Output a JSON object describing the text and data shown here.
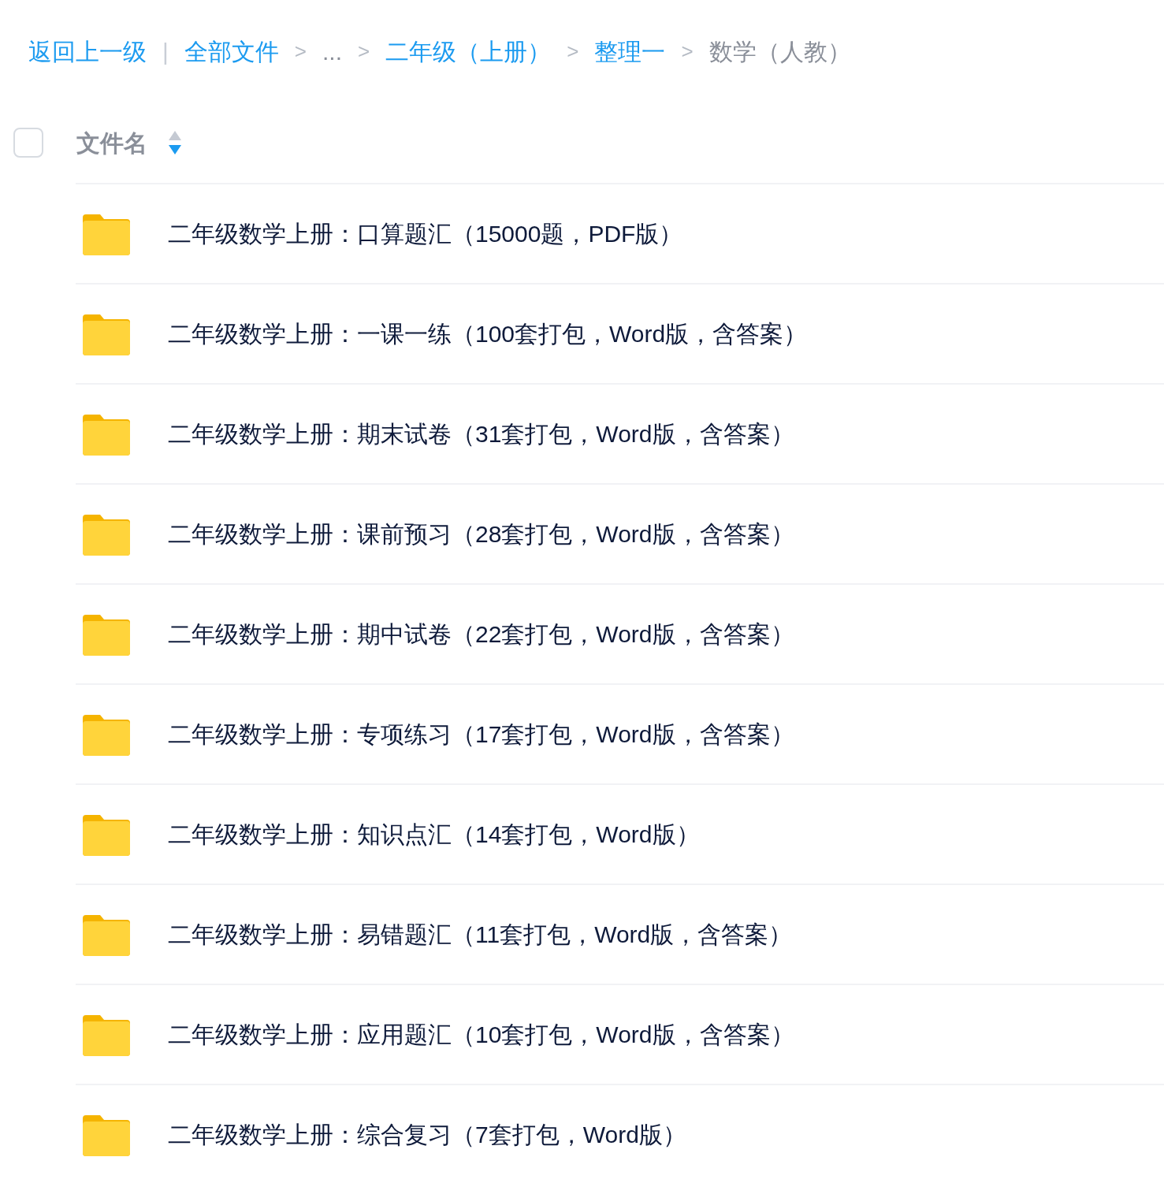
{
  "breadcrumb": {
    "back": "返回上一级",
    "divider": "|",
    "items": [
      {
        "label": "全部文件",
        "kind": "link"
      },
      {
        "separator": ">",
        "label": "...",
        "kind": "text"
      },
      {
        "separator": ">",
        "label": "二年级（上册）",
        "kind": "link"
      },
      {
        "separator": ">",
        "label": "整理一",
        "kind": "link"
      },
      {
        "separator": ">",
        "label": "数学（人教）",
        "kind": "current"
      }
    ]
  },
  "table": {
    "select_all": {
      "checked": false
    },
    "column": {
      "label": "文件名",
      "sorted_descending": true
    },
    "rows": [
      {
        "kind": "folder",
        "name": "二年级数学上册：口算题汇（15000题，PDF版）"
      },
      {
        "kind": "folder",
        "name": "二年级数学上册：一课一练（100套打包，Word版，含答案）"
      },
      {
        "kind": "folder",
        "name": "二年级数学上册：期末试卷（31套打包，Word版，含答案）"
      },
      {
        "kind": "folder",
        "name": "二年级数学上册：课前预习（28套打包，Word版，含答案）"
      },
      {
        "kind": "folder",
        "name": "二年级数学上册：期中试卷（22套打包，Word版，含答案）"
      },
      {
        "kind": "folder",
        "name": "二年级数学上册：专项练习（17套打包，Word版，含答案）"
      },
      {
        "kind": "folder",
        "name": "二年级数学上册：知识点汇（14套打包，Word版）"
      },
      {
        "kind": "folder",
        "name": "二年级数学上册：易错题汇（11套打包，Word版，含答案）"
      },
      {
        "kind": "folder",
        "name": "二年级数学上册：应用题汇（10套打包，Word版，含答案）"
      },
      {
        "kind": "folder",
        "name": "二年级数学上册：综合复习（7套打包，Word版）"
      }
    ]
  }
}
